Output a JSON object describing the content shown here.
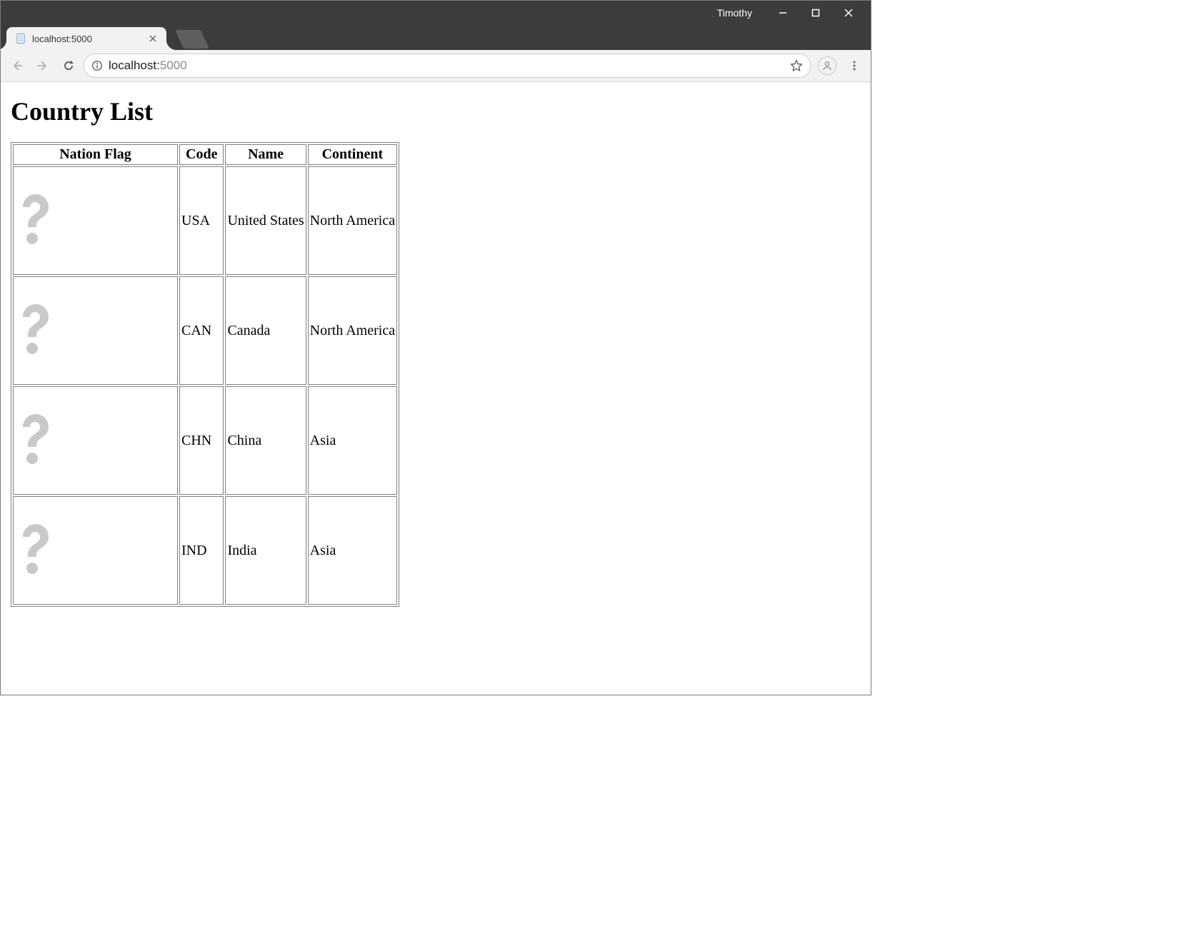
{
  "window": {
    "user": "Timothy"
  },
  "browser": {
    "tab_title": "localhost:5000",
    "url_host": "localhost:",
    "url_port": "5000"
  },
  "page": {
    "heading": "Country List",
    "table": {
      "headers": [
        "Nation Flag",
        "Code",
        "Name",
        "Continent"
      ],
      "rows": [
        {
          "code": "USA",
          "name": "United States",
          "continent": "North America"
        },
        {
          "code": "CAN",
          "name": "Canada",
          "continent": "North America"
        },
        {
          "code": "CHN",
          "name": "China",
          "continent": "Asia"
        },
        {
          "code": "IND",
          "name": "India",
          "continent": "Asia"
        }
      ]
    }
  }
}
